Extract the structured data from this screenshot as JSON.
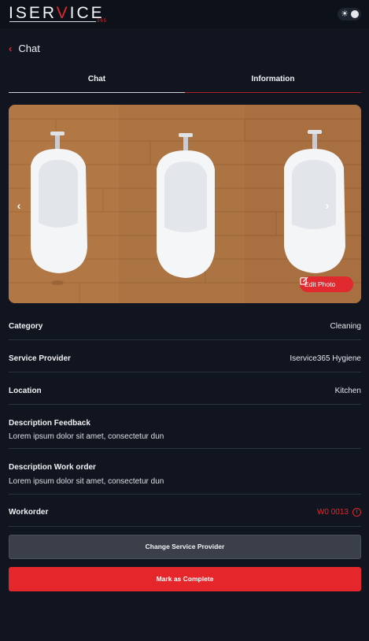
{
  "header": {
    "logo": {
      "main": "ISERVICE",
      "sub": "365"
    },
    "theme_toggle_icon": "sun-icon"
  },
  "nav": {
    "back_label": "Chat",
    "back_icon": "chevron-left-icon"
  },
  "tabs": [
    {
      "label": "Chat",
      "active": true
    },
    {
      "label": "Information",
      "active": false
    }
  ],
  "photo": {
    "edit_label": "Edit Photo",
    "prev_icon": "chevron-left-icon",
    "next_icon": "chevron-right-icon",
    "edit_icon": "edit-icon"
  },
  "details": {
    "category": {
      "label": "Category",
      "value": "Cleaning"
    },
    "service_provider": {
      "label": "Service Provider",
      "value": "Iservice365 Hygiene"
    },
    "location": {
      "label": "Location",
      "value": "Kitchen"
    },
    "description_feedback": {
      "label": "Description Feedback",
      "value": "Lorem ipsum dolor sit amet, consectetur dun"
    },
    "description_work_order": {
      "label": "Description Work order",
      "value": "Lorem ipsum dolor sit amet, consectetur dun"
    },
    "workorder": {
      "label": "Workorder",
      "value": "W0 0013",
      "icon": "info-icon"
    }
  },
  "actions": {
    "change_provider_label": "Change Service Provider",
    "mark_complete_label": "Mark as Complete"
  },
  "colors": {
    "background": "#111520",
    "accent": "#e5262a",
    "divider": "#2a303c",
    "secondary_button": "#3a3f49"
  }
}
